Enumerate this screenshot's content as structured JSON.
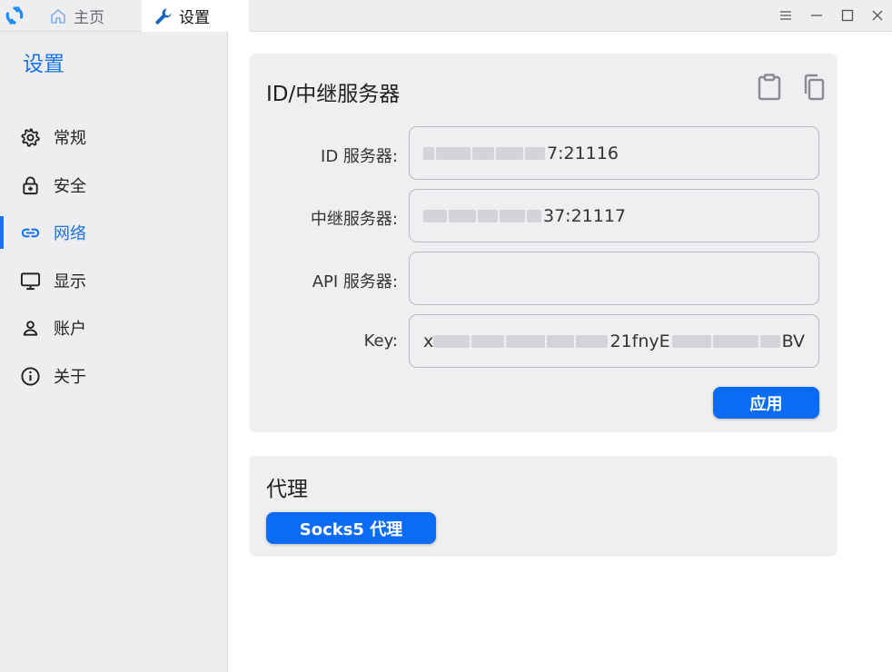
{
  "titlebar": {
    "tabs": [
      {
        "label": "主页",
        "icon": "home-icon"
      },
      {
        "label": "设置",
        "icon": "wrench-icon"
      }
    ],
    "window_controls": [
      "menu-icon",
      "minimize-icon",
      "maximize-icon",
      "close-icon"
    ]
  },
  "sidebar": {
    "title": "设置",
    "items": [
      {
        "label": "常规",
        "icon": "gear-icon",
        "active": false
      },
      {
        "label": "安全",
        "icon": "lock-icon",
        "active": false
      },
      {
        "label": "网络",
        "icon": "link-icon",
        "active": true
      },
      {
        "label": "显示",
        "icon": "monitor-icon",
        "active": false
      },
      {
        "label": "账户",
        "icon": "user-icon",
        "active": false
      },
      {
        "label": "关于",
        "icon": "info-icon",
        "active": false
      }
    ]
  },
  "server_card": {
    "title": "ID/中继服务器",
    "fields": [
      {
        "label": "ID 服务器:",
        "value_visible": "7:21116"
      },
      {
        "label": "中继服务器:",
        "value_visible": "37:21117"
      },
      {
        "label": "API 服务器:",
        "value_visible": ""
      },
      {
        "label": "Key:",
        "value_prefix": "x",
        "value_middle": "21fnyE",
        "value_suffix": "BV"
      }
    ],
    "apply_label": "应用"
  },
  "proxy_card": {
    "title": "代理",
    "socks_label": "Socks5 代理"
  },
  "colors": {
    "accent": "#1a73e8",
    "button": "#0a6cf5",
    "sidebar_bg": "#eeeef1",
    "card_bg": "#efeff2"
  }
}
